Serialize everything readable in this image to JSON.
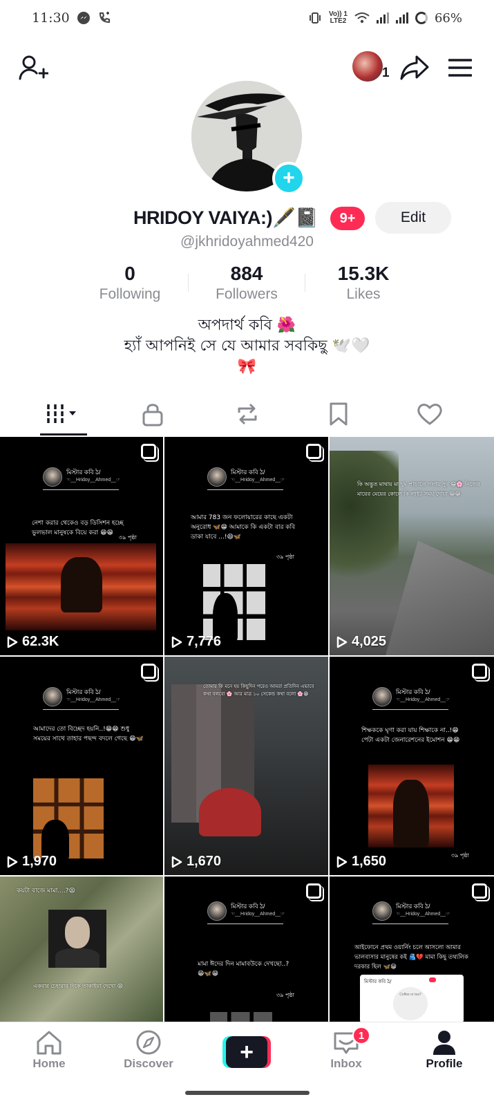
{
  "status_bar": {
    "time": "11:30",
    "network_label_top": "Vo)) 1",
    "network_label_bottom": "LTE2",
    "battery": "66%"
  },
  "header": {
    "friends_count": "1"
  },
  "profile": {
    "display_name": "HRIDOY VAIYA:)🖋️📓",
    "notification_badge": "9+",
    "edit_label": "Edit",
    "username": "@jkhridoyahmed420",
    "stats": [
      {
        "value": "0",
        "label": "Following"
      },
      {
        "value": "884",
        "label": "Followers"
      },
      {
        "value": "15.3K",
        "label": "Likes"
      }
    ],
    "bio": [
      "অপদার্থ কবি 🌺",
      "হ্যাঁ আপনিই সে যে আমার সবকিছু 🕊️🤍",
      "🎀"
    ]
  },
  "tabs": [
    {
      "name": "videos",
      "icon": "grid-bars-icon",
      "active": true
    },
    {
      "name": "private",
      "icon": "lock-icon"
    },
    {
      "name": "reposts",
      "icon": "repost-icon"
    },
    {
      "name": "favorites",
      "icon": "bookmark-icon"
    },
    {
      "name": "liked",
      "icon": "heart-icon"
    }
  ],
  "videos": [
    {
      "views": "62.3K",
      "caption": "নেশা করার থেকেও বড় ডিসিশন হচ্ছে ভুলভাল মানুষকে বিয়ে করা 😁😁",
      "page": "৩৯ পৃষ্ঠা",
      "header_name": "মিস্টার কবি ঠ/",
      "header_sub": "☜__Hridoy__Ahmed__☞"
    },
    {
      "views": "7,776",
      "caption": "আমার 783 জন ফলোয়ারের কাছে একটা অনুরোধ 🦋😁 আমাকে কি একটা বার কবি ডাকা যাবে ...!😄🦋",
      "page": "৩৯ পৃষ্ঠা",
      "header_name": "মিস্টার কবি ঠ/",
      "header_sub": "☜__Hridoy__Ahmed__☞"
    },
    {
      "views": "4,025",
      "caption": "কি অদ্ভুত মাথায় মা ঘুম পাড়াতে গলায় সুর 😁🌸 নিজের মায়ের মেয়ের কোলে কি লাইট সময় দোয়া 😁😁",
      "page": "",
      "header_name": "",
      "header_sub": ""
    },
    {
      "views": "1,970",
      "caption": "আমাদের তো বিচ্ছেদ হয়নি..!😁😁 শুধু সময়ের সাথে তাহার পছন্দ বদলে গেছে 😁🦋",
      "page": "",
      "header_name": "মিস্টার কবি ঠ/",
      "header_sub": "☜__Hridoy__Ahmed__☞"
    },
    {
      "views": "1,670",
      "caption": "তোমার কি মনে হয় কিছুদিন পরেও আমরা প্রতিদিন এভাবে কথা বলবো 🌸 আর মাত্র ১০ সেকেন্ড কথা বলো 🌸😁",
      "page": "",
      "header_name": "",
      "header_sub": ""
    },
    {
      "views": "1,650",
      "caption": "শিক্ষককে ঘৃণা করা যায় শিক্ষাকে না..!😁 পেটা একটা জেনারেশনের ইমোশন 😁😁",
      "page": "৩৯ পৃষ্ঠা",
      "header_name": "মিস্টার কবি ঠ/",
      "header_sub": "☜__Hridoy__Ahmed__☞"
    },
    {
      "views": "",
      "caption": "কয়টা বাজে মামা....?😫",
      "caption2": "একবার চেহারার দিকে তাকাইয়া দেখো 😫",
      "page": "",
      "header_name": "",
      "header_sub": ""
    },
    {
      "views": "",
      "caption": "মামা ঈদের দিন মামাবউকে দেখছো..?😁🦋😁",
      "page": "৩৯ পৃষ্ঠা",
      "header_name": "মিস্টার কবি ঠ/",
      "header_sub": "☜__Hridoy__Ahmed__☞"
    },
    {
      "views": "",
      "caption": "আইফোনে প্রথম ওয়ার্নিং চলে আসলো আমার ভালবাসার মানুষের কই 🫂💔 মামা কিছু তথ্যলিক দরকার ছিল 🦋😁",
      "page": "",
      "header_name": "মিস্টার কবি ঠ/",
      "header_sub": "☜__Hridoy__Ahmed__☞",
      "inner_card_title": "মিস্টার কবি ঠ/",
      "inner_card_text": "Coffee or tea?"
    }
  ],
  "bottom_nav": [
    {
      "label": "Home",
      "icon": "home-icon"
    },
    {
      "label": "Discover",
      "icon": "compass-icon"
    },
    {
      "label": "",
      "icon": "create-plus-icon"
    },
    {
      "label": "Inbox",
      "icon": "inbox-icon",
      "badge": "1"
    },
    {
      "label": "Profile",
      "icon": "profile-icon",
      "active": true
    }
  ],
  "colors": {
    "accent_pink": "#fe2c55",
    "accent_cyan": "#25f4ee",
    "avatar_plus": "#20d5ec",
    "muted_text": "#8a8b91"
  }
}
